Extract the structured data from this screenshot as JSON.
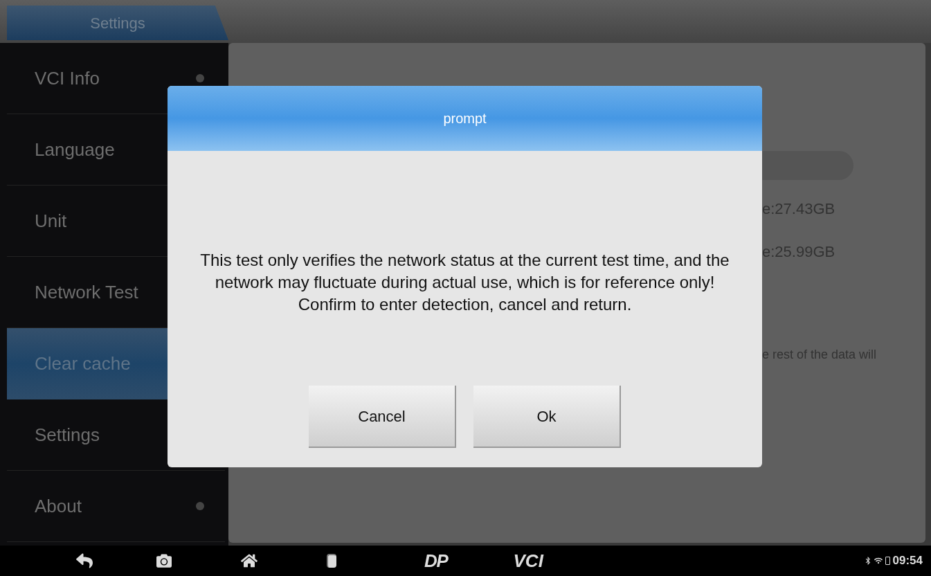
{
  "breadcrumb": {
    "label": "Settings"
  },
  "sidebar": {
    "items": [
      {
        "label": "VCI Info",
        "selected": false,
        "dot": true
      },
      {
        "label": "Language",
        "selected": false
      },
      {
        "label": "Unit",
        "selected": false
      },
      {
        "label": "Network Test",
        "selected": false
      },
      {
        "label": "Clear cache",
        "selected": true
      },
      {
        "label": "Settings",
        "selected": false
      },
      {
        "label": "About",
        "selected": false,
        "dot": true
      }
    ]
  },
  "panel": {
    "storage_lines": [
      "e:27.43GB",
      "e:25.99GB"
    ],
    "note": "e rest of the data will"
  },
  "dialog": {
    "title": "prompt",
    "message": "This test only verifies the network status at the current test time, and the network may fluctuate during actual use, which is for reference only! Confirm to enter detection, cancel and return.",
    "buttons": [
      "Cancel",
      "Ok"
    ]
  },
  "nav_bar": {
    "logos": [
      "DP",
      "VCI"
    ],
    "time": "09:54"
  }
}
